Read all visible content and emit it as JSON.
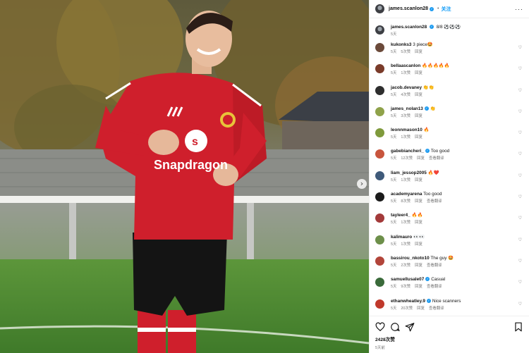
{
  "header": {
    "username": "james.scanlon28",
    "follow_label": "关注",
    "more_label": "···",
    "separator": "•"
  },
  "caption": {
    "username": "james.scanlon28",
    "text": "8/8 ⚽⚽⚽",
    "time": "5天"
  },
  "comments": [
    {
      "username": "kukonks3",
      "verified": false,
      "text": "3 piece🤩",
      "time": "5天",
      "likes": "5次赞",
      "reply": "回复",
      "translate": "",
      "avatar_color": "#6b4a3a"
    },
    {
      "username": "bellaascanlon",
      "verified": false,
      "text": "🔥🔥🔥🔥🔥",
      "time": "5天",
      "likes": "1次赞",
      "reply": "回复",
      "translate": "",
      "avatar_color": "#7a3b2a"
    },
    {
      "username": "jacob.devaney",
      "verified": false,
      "text": "👏👏",
      "time": "5天",
      "likes": "4次赞",
      "reply": "回复",
      "translate": "",
      "avatar_color": "#2e2e2e"
    },
    {
      "username": "james_nolan13",
      "verified": true,
      "text": "👏",
      "time": "5天",
      "likes": "3次赞",
      "reply": "回复",
      "translate": "",
      "avatar_color": "#8fa24a"
    },
    {
      "username": "leonnmason10",
      "verified": false,
      "text": "🔥",
      "time": "5天",
      "likes": "1次赞",
      "reply": "回复",
      "translate": "",
      "avatar_color": "#7f9a3c"
    },
    {
      "username": "gabebiancheri_",
      "verified": true,
      "text": "Too good",
      "time": "5天",
      "likes": "12次赞",
      "reply": "回复",
      "translate": "查看翻译",
      "avatar_color": "#c8553d"
    },
    {
      "username": "liam_jessop2005",
      "verified": false,
      "text": "🔥❤️",
      "time": "5天",
      "likes": "1次赞",
      "reply": "回复",
      "translate": "",
      "avatar_color": "#3f5a7a"
    },
    {
      "username": "academyarena",
      "verified": false,
      "text": "Too good",
      "time": "5天",
      "likes": "8次赞",
      "reply": "回复",
      "translate": "查看翻译",
      "avatar_color": "#1b1b1b"
    },
    {
      "username": "tayleer4_",
      "verified": false,
      "text": "🔥🔥",
      "time": "5天",
      "likes": "1次赞",
      "reply": "回复",
      "translate": "",
      "avatar_color": "#a33a3a"
    },
    {
      "username": "kalimauro",
      "verified": false,
      "text": "👀👀",
      "time": "5天",
      "likes": "1次赞",
      "reply": "回复",
      "translate": "",
      "avatar_color": "#6d8f4a"
    },
    {
      "username": "bassirou_nkoto10",
      "verified": false,
      "text": "The guy 🤩",
      "time": "5天",
      "likes": "2次赞",
      "reply": "回复",
      "translate": "查看翻译",
      "avatar_color": "#b2453a"
    },
    {
      "username": "samuellusale07",
      "verified": true,
      "text": "Casual",
      "time": "5天",
      "likes": "9次赞",
      "reply": "回复",
      "translate": "查看翻译",
      "avatar_color": "#3a6a3a"
    },
    {
      "username": "ethanwheatley.9",
      "verified": true,
      "text": "Nice scanners",
      "time": "5天",
      "likes": "20次赞",
      "reply": "回复",
      "translate": "查看翻译",
      "avatar_color": "#c0392b"
    }
  ],
  "actions": {
    "likes": "2428次赞",
    "time": "5天前"
  },
  "photo": {
    "sponsor_text": "Snapdragon",
    "next_arrow": "›"
  },
  "colors": {
    "accent": "#0095f6",
    "verified": "#1d9bf0",
    "kit_red": "#cf1f2c",
    "kit_shorts": "#111111"
  }
}
